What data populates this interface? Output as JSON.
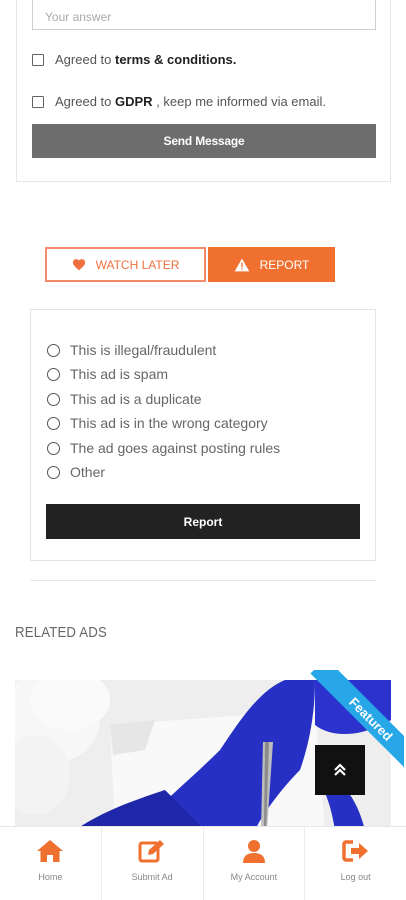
{
  "form": {
    "answer_placeholder": "Your answer",
    "terms": {
      "prefix": "Agreed to",
      "bold": "terms & conditions."
    },
    "gdpr": {
      "prefix": "Agreed to",
      "bold": "GDPR",
      "suffix": ", keep me informed via email."
    },
    "send_label": "Send Message"
  },
  "actions": {
    "watch_later_label": "WATCH LATER",
    "report_label": "REPORT"
  },
  "report": {
    "reasons": [
      "This is illegal/fraudulent",
      "This ad is spam",
      "This ad is a duplicate",
      "This ad is in the wrong category",
      "The ad goes against posting rules",
      "Other"
    ],
    "submit_label": "Report"
  },
  "related": {
    "title": "RELATED ADS",
    "featured_label": "Featured"
  },
  "bottom_nav": {
    "items": [
      {
        "label": "Home",
        "icon": "home-icon"
      },
      {
        "label": "Submit Ad",
        "icon": "edit-icon"
      },
      {
        "label": "My Account",
        "icon": "user-icon"
      },
      {
        "label": "Log out",
        "icon": "logout-icon"
      }
    ]
  },
  "colors": {
    "accent": "#f07030",
    "dark": "#222222",
    "ribbon": "#27a6e8",
    "send_button": "#6d6d6d"
  }
}
